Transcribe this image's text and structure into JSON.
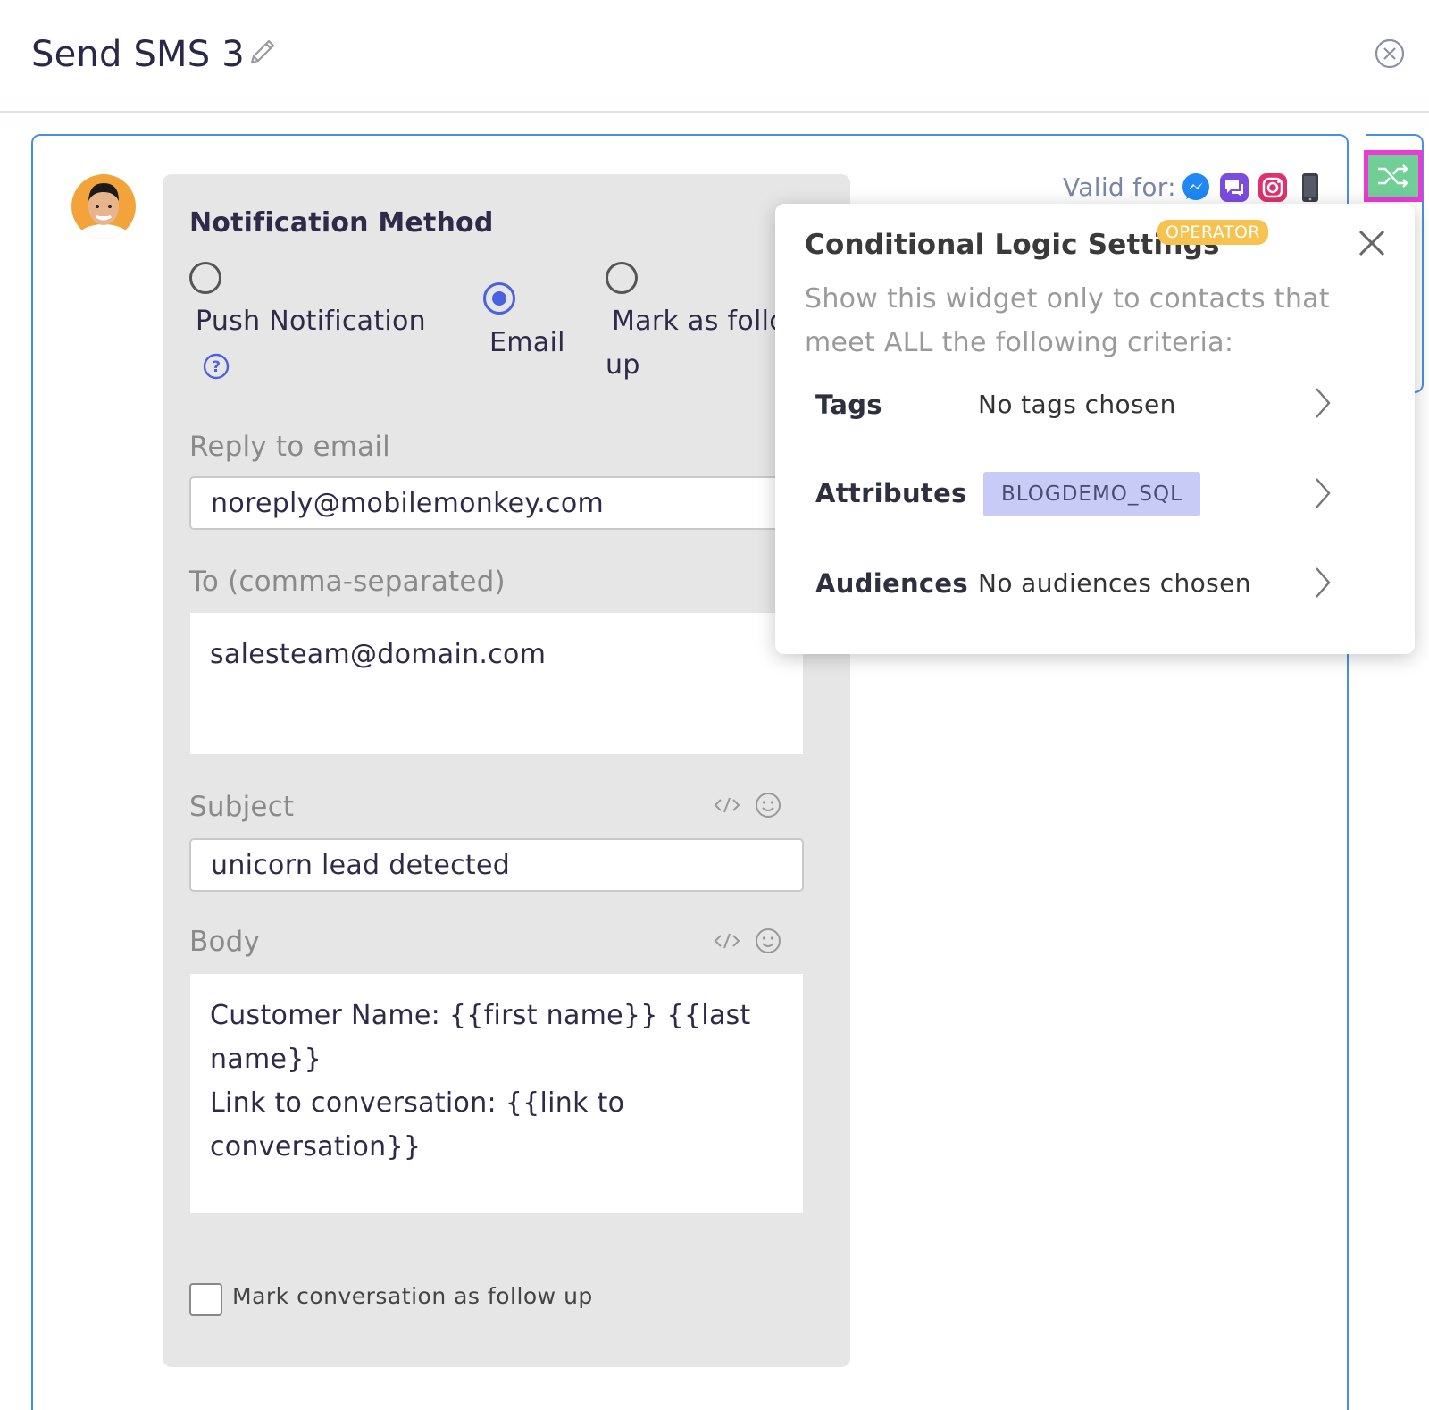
{
  "header": {
    "title": "Send SMS 3"
  },
  "form": {
    "section_title": "Notification Method",
    "radio_options": [
      {
        "label_line1": "Push Notification",
        "selected": false
      },
      {
        "label_line1": "Email",
        "selected": true
      },
      {
        "label_line1": "Mark as follo",
        "label_line2": "up",
        "selected": false
      }
    ],
    "reply_to": {
      "label": "Reply to email",
      "value": "noreply@mobilemonkey.com"
    },
    "to": {
      "label": "To (comma-separated)",
      "value": "salesteam@domain.com"
    },
    "subject": {
      "label": "Subject",
      "value": "unicorn lead detected"
    },
    "body": {
      "label": "Body",
      "lines": [
        "Customer Name: {{first name}} {{last",
        "name}}",
        "Link to conversation: {{link to",
        "conversation}}"
      ]
    },
    "checkbox_label": "Mark conversation as follow up"
  },
  "valid_for": {
    "label": "Valid for:",
    "platforms": [
      "messenger-icon",
      "chat-icon",
      "instagram-icon",
      "phone-icon"
    ]
  },
  "popover": {
    "title": "Conditional Logic Settings",
    "badge": "OPERATOR",
    "description": "Show this widget only to contacts that meet ALL the following criteria:",
    "rows": [
      {
        "label": "Tags",
        "value": "No tags chosen"
      },
      {
        "label": "Attributes",
        "chip": "BLOGDEMO_SQL"
      },
      {
        "label": "Audiences",
        "value": "No audiences chosen"
      }
    ]
  },
  "colors": {
    "accent_blue": "#4a90e2",
    "radio_selected": "#4a62e0",
    "badge": "#f6c351",
    "chip": "#c8cbf5",
    "shuffle_button": "#6fcf97",
    "highlight": "#ea3ad3"
  }
}
